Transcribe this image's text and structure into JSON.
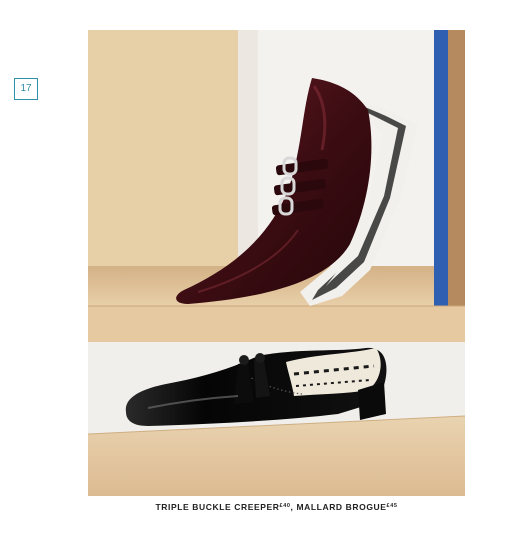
{
  "page": {
    "number": "17"
  },
  "caption": {
    "items": [
      {
        "name": "TRIPLE BUCKLE CREEPER",
        "price": "£40"
      },
      {
        "name": "MALLARD BROGUE",
        "price": "£45"
      }
    ],
    "separator": ", "
  },
  "colors": {
    "accent": "#2f8fa6",
    "wall_beige": "#e6cfa8",
    "wall_white": "#f3f1ee",
    "shelf_wood": "#e0c29a",
    "blue_panel": "#2f5fb0",
    "burgundy": "#4a1218",
    "black_patent": "#0d0d0d"
  },
  "image": {
    "subjects": [
      "creeper-shoe",
      "brogue-shoe"
    ]
  }
}
